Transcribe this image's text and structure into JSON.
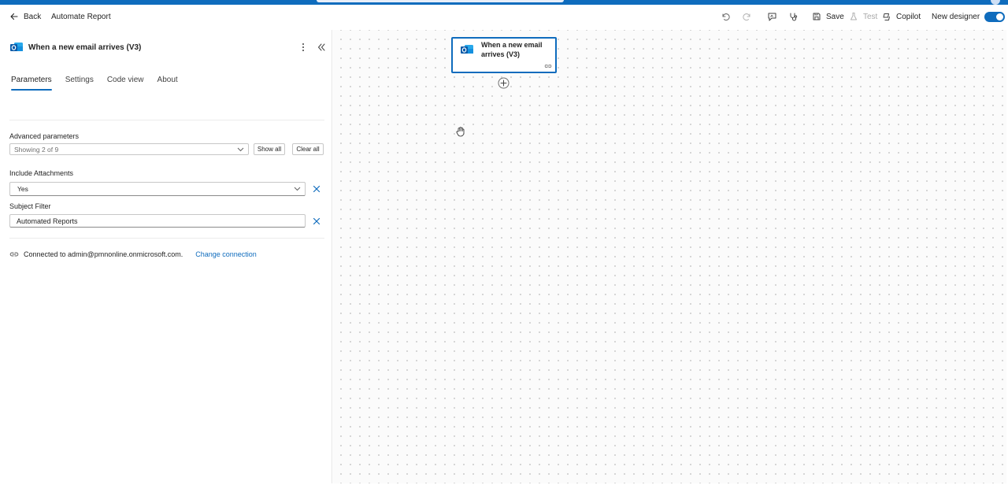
{
  "app": {
    "back_label": "Back",
    "flow_name": "Automate Report"
  },
  "toolbar": {
    "save_label": "Save",
    "test_label": "Test",
    "copilot_label": "Copilot",
    "new_designer_label": "New designer",
    "new_designer_on": true
  },
  "panel": {
    "title": "When a new email arrives (V3)",
    "tabs": [
      {
        "label": "Parameters",
        "active": true
      },
      {
        "label": "Settings",
        "active": false
      },
      {
        "label": "Code view",
        "active": false
      },
      {
        "label": "About",
        "active": false
      }
    ],
    "advanced": {
      "label": "Advanced parameters",
      "value": "Showing 2 of 9",
      "show_all_label": "Show all",
      "clear_all_label": "Clear all"
    },
    "include_attachments": {
      "label": "Include Attachments",
      "value": "Yes"
    },
    "subject_filter": {
      "label": "Subject Filter",
      "value": "Automated Reports"
    },
    "connection": {
      "text": "Connected to admin@pmnonline.onmicrosoft.com.",
      "change_label": "Change connection"
    }
  },
  "canvas": {
    "node_title": "When a new email arrives (V3)"
  },
  "colors": {
    "accent": "#0f6cbd",
    "outlook": "#0a5aa8"
  }
}
